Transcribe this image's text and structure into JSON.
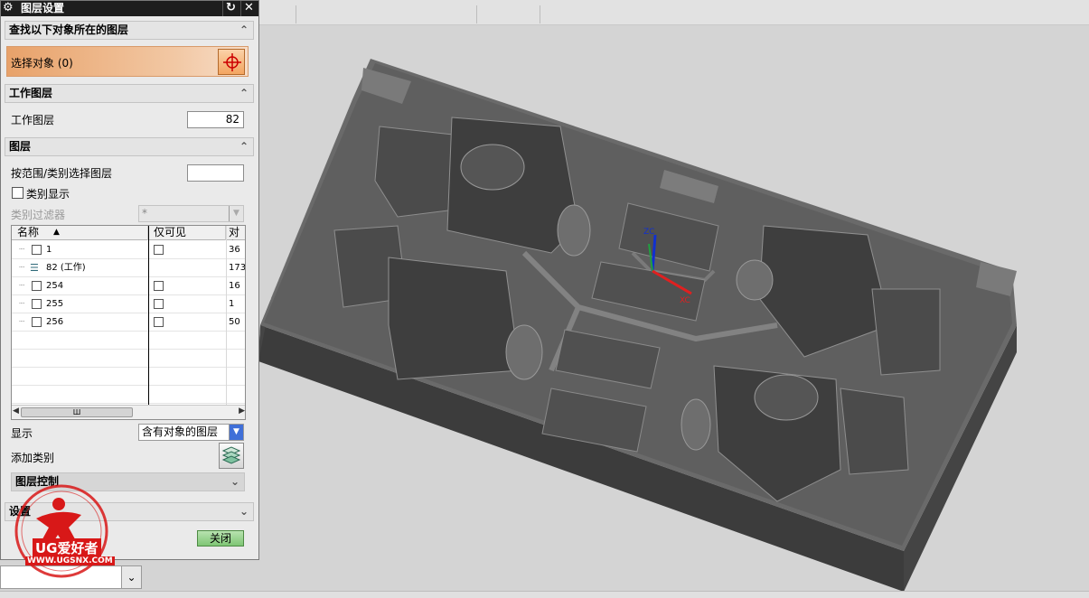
{
  "dialog": {
    "title": "图层设置",
    "reset_icon": "↻",
    "close_icon": "✕",
    "sections": {
      "find": "查找以下对象所在的图层",
      "work_layer": "工作图层",
      "layers": "图层",
      "layer_control": "图层控制",
      "settings": "设置"
    },
    "select_object_label": "选择对象 (0)",
    "work_layer_label": "工作图层",
    "work_layer_value": "82",
    "range_label": "按范围/类别选择图层",
    "range_value": "",
    "category_display_label": "类别显示",
    "category_filter_label": "类别过滤器",
    "category_filter_value": "*",
    "table": {
      "columns": [
        "名称",
        "仅可见",
        "对象"
      ],
      "rows": [
        {
          "name": "1",
          "count": "36",
          "work": false
        },
        {
          "name": "82 (工作)",
          "count": "173",
          "work": true
        },
        {
          "name": "254",
          "count": "16",
          "work": false
        },
        {
          "name": "255",
          "count": "1",
          "work": false
        },
        {
          "name": "256",
          "count": "50",
          "work": false
        }
      ],
      "scroll_thumb": "Ш"
    },
    "display_label": "显示",
    "display_value": "含有对象的图层",
    "add_category_label": "添加类别",
    "close_button": "关闭"
  },
  "triad": {
    "z": "ZC",
    "x": "XC"
  },
  "watermark": {
    "brand": "UG爱好者",
    "url": "WWW.UGSNX.COM"
  },
  "colors": {
    "titlebar": "#1e1e1e",
    "select_accent": "#e8a26a",
    "close_button": "#7ec574",
    "model": "#5a5a5a"
  }
}
